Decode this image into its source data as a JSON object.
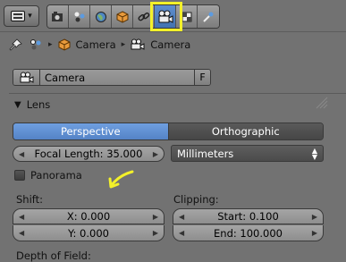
{
  "context_tabs": [
    {
      "icon": "render-icon",
      "active": false
    },
    {
      "icon": "render-layers-icon",
      "active": false
    },
    {
      "icon": "world-icon",
      "active": false
    },
    {
      "icon": "object-icon",
      "active": false
    },
    {
      "icon": "constraints-icon",
      "active": false
    },
    {
      "icon": "camera-data-icon",
      "active": true
    },
    {
      "icon": "texture-icon",
      "active": false
    },
    {
      "icon": "physics-icon",
      "active": false
    }
  ],
  "breadcrumb": {
    "items": [
      "Camera",
      "Camera"
    ]
  },
  "datablock": {
    "name": "Camera",
    "fake_user_label": "F"
  },
  "lens_panel": {
    "title": "Lens",
    "projection": {
      "options": [
        "Perspective",
        "Orthographic"
      ],
      "selected": "Perspective"
    },
    "focal_length": "Focal Length: 35.000",
    "lens_unit": "Millimeters",
    "panorama_label": "Panorama",
    "panorama_checked": false,
    "shift_label": "Shift:",
    "shift_x": "X: 0.000",
    "shift_y": "Y: 0.000",
    "clipping_label": "Clipping:",
    "clip_start": "Start: 0.100",
    "clip_end": "End: 100.000"
  },
  "dof_label": "Depth of Field:",
  "colors": {
    "highlight": "#f3f12a",
    "active_blue": "#5a8ad0",
    "panel_bg": "#727272"
  }
}
